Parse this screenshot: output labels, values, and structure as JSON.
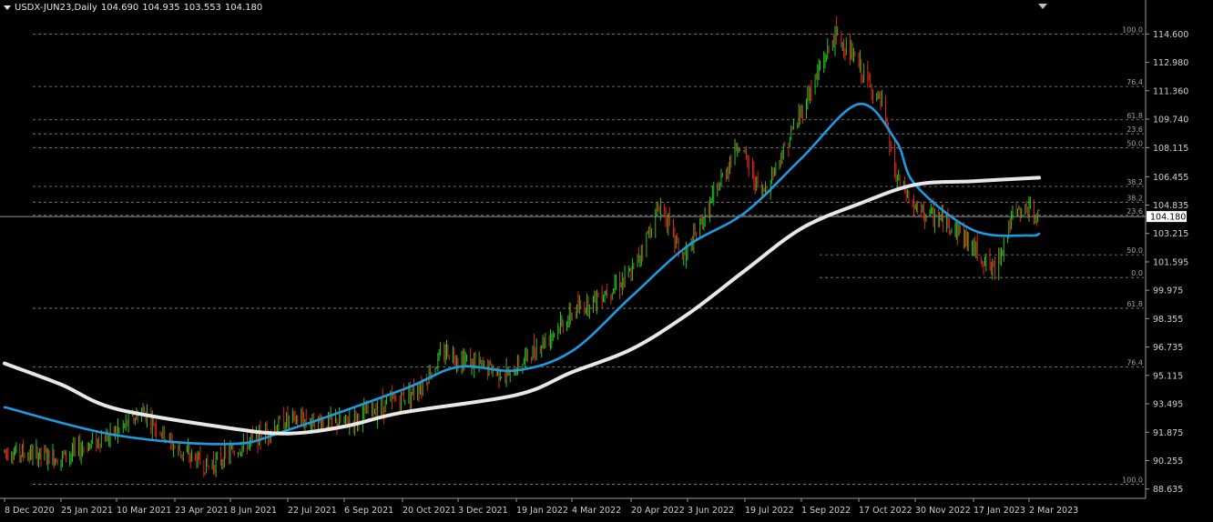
{
  "header": {
    "symbol": "USDX-JUN23,Daily",
    "open": "104.690",
    "high": "104.935",
    "low": "103.553",
    "close": "104.180"
  },
  "chart_data": {
    "type": "candlestick",
    "symbol": "USDX-JUN23",
    "timeframe": "Daily",
    "ylim": [
      88.1,
      115.5
    ],
    "y_ticks": [
      "114.600",
      "112.980",
      "111.360",
      "109.740",
      "108.115",
      "106.455",
      "104.835",
      "103.215",
      "101.595",
      "99.975",
      "98.355",
      "96.735",
      "95.115",
      "93.495",
      "91.875",
      "90.255",
      "88.635"
    ],
    "x_ticks": [
      "8 Dec 2020",
      "25 Jan 2021",
      "10 Mar 2021",
      "23 Apr 2021",
      "8 Jun 2021",
      "22 Jul 2021",
      "6 Sep 2021",
      "20 Oct 2021",
      "3 Dec 2021",
      "19 Jan 2022",
      "4 Mar 2022",
      "20 Apr 2022",
      "3 Jun 2022",
      "19 Jul 2022",
      "1 Sep 2022",
      "17 Oct 2022",
      "30 Nov 2022",
      "17 Jan 2023",
      "2 Mar 2023"
    ],
    "current_price": "104.180",
    "colors": {
      "background": "#000000",
      "bull": "#22c722",
      "bear": "#e0281c",
      "ma_fast": "#1e9be0",
      "ma_slow": "#e8e8e8",
      "fib": "#8a8a8a",
      "text": "#cfcfcf"
    },
    "price_path": [
      [
        "8 Dec 2020",
        90.8
      ],
      [
        "25 Jan 2021",
        90.4
      ],
      [
        "10 Mar 2021",
        91.9
      ],
      [
        "30 Mar 2021",
        93.1
      ],
      [
        "23 Apr 2021",
        91.0
      ],
      [
        "20 May 2021",
        89.9
      ],
      [
        "8 Jun 2021",
        90.7
      ],
      [
        "22 Jul 2021",
        92.6
      ],
      [
        "6 Sep 2021",
        92.4
      ],
      [
        "20 Oct 2021",
        93.9
      ],
      [
        "3 Nov 2021",
        94.5
      ],
      [
        "24 Nov 2021",
        96.6
      ],
      [
        "3 Dec 2021",
        96.1
      ],
      [
        "14 Jan 2022",
        95.1
      ],
      [
        "19 Jan 2022",
        95.6
      ],
      [
        "4 Mar 2022",
        98.6
      ],
      [
        "20 Apr 2022",
        100.9
      ],
      [
        "13 May 2022",
        104.9
      ],
      [
        "30 May 2022",
        101.8
      ],
      [
        "3 Jun 2022",
        102.1
      ],
      [
        "14 Jul 2022",
        108.4
      ],
      [
        "1 Aug 2022",
        105.4
      ],
      [
        "19 Aug 2022",
        108.1
      ],
      [
        "28 Sep 2022",
        114.6
      ],
      [
        "17 Oct 2022",
        112.8
      ],
      [
        "4 Nov 2022",
        110.5
      ],
      [
        "15 Nov 2022",
        106.4
      ],
      [
        "30 Nov 2022",
        104.6
      ],
      [
        "2 Jan 2023",
        103.6
      ],
      [
        "2 Feb 2023",
        101.1
      ],
      [
        "17 Feb 2023",
        104.2
      ],
      [
        "2 Mar 2023",
        104.6
      ],
      [
        "10 Mar 2023",
        104.18
      ]
    ],
    "series": [
      {
        "values": [
          [
            "8 Dec 2020",
            93.3
          ],
          [
            "10 Mar 2021",
            91.7
          ],
          [
            "8 Jun 2021",
            91.2
          ],
          [
            "22 Jul 2021",
            92.0
          ],
          [
            "20 Oct 2021",
            94.3
          ],
          [
            "3 Dec 2021",
            95.6
          ],
          [
            "19 Jan 2022",
            95.4
          ],
          [
            "4 Mar 2022",
            96.5
          ],
          [
            "20 Apr 2022",
            99.6
          ],
          [
            "3 Jun 2022",
            102.5
          ],
          [
            "19 Jul 2022",
            104.4
          ],
          [
            "1 Sep 2022",
            107.5
          ],
          [
            "17 Oct 2022",
            110.6
          ],
          [
            "15 Nov 2022",
            108.5
          ],
          [
            "30 Nov 2022",
            106.0
          ],
          [
            "17 Jan 2023",
            103.4
          ],
          [
            "2 Mar 2023",
            103.1
          ],
          [
            "10 Mar 2023",
            103.2
          ]
        ]
      },
      {
        "values": [
          [
            "8 Dec 2020",
            95.8
          ],
          [
            "25 Jan 2021",
            94.6
          ],
          [
            "10 Mar 2021",
            93.2
          ],
          [
            "8 Jun 2021",
            92.1
          ],
          [
            "22 Jul 2021",
            91.8
          ],
          [
            "6 Sep 2021",
            92.2
          ],
          [
            "20 Oct 2021",
            93.0
          ],
          [
            "19 Jan 2022",
            94.0
          ],
          [
            "4 Mar 2022",
            95.3
          ],
          [
            "20 Apr 2022",
            96.6
          ],
          [
            "3 Jun 2022",
            98.6
          ],
          [
            "19 Jul 2022",
            101.1
          ],
          [
            "1 Sep 2022",
            103.5
          ],
          [
            "17 Oct 2022",
            104.9
          ],
          [
            "30 Nov 2022",
            106.0
          ],
          [
            "17 Jan 2023",
            106.2
          ],
          [
            "10 Mar 2023",
            106.4
          ]
        ]
      }
    ],
    "fib_levels": [
      {
        "label": "100.0",
        "price": 114.6
      },
      {
        "label": "76.4",
        "price": 111.6
      },
      {
        "label": "61.8",
        "price": 109.7
      },
      {
        "label": "23.6",
        "price": 108.9
      },
      {
        "label": "50.0",
        "price": 108.1
      },
      {
        "label": "38.2",
        "price": 105.9
      },
      {
        "label": "38.2",
        "price": 105.0
      },
      {
        "label": "23.6",
        "price": 104.25
      },
      {
        "label": "50.0",
        "price": 102.0
      },
      {
        "label": "0.0",
        "price": 100.7
      },
      {
        "label": "61.8",
        "price": 98.95
      },
      {
        "label": "76.4",
        "price": 95.6
      },
      {
        "label": "100.0",
        "price": 88.9
      }
    ]
  }
}
